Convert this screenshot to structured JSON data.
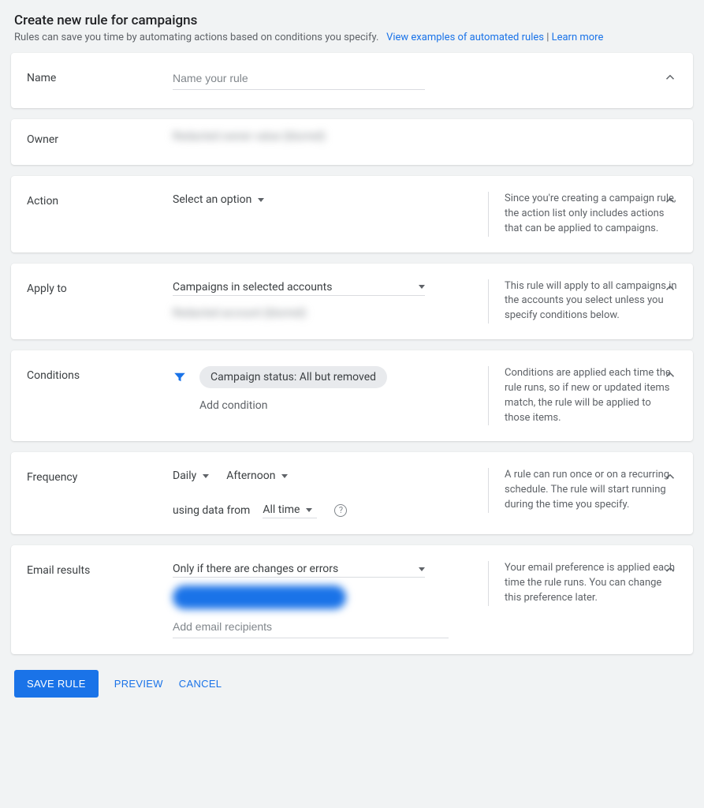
{
  "header": {
    "title": "Create new rule for campaigns",
    "subtitle": "Rules can save you time by automating actions based on conditions you specify.",
    "link_examples": "View examples of automated rules",
    "link_learn": "Learn more",
    "divider": " | "
  },
  "name": {
    "label": "Name",
    "placeholder": "Name your rule"
  },
  "owner": {
    "label": "Owner",
    "value_blurred": "Redacted owner value (blurred)"
  },
  "action": {
    "label": "Action",
    "select_label": "Select an option",
    "help": "Since you're creating a campaign rule, the action list only includes actions that can be applied to campaigns."
  },
  "apply_to": {
    "label": "Apply to",
    "select_label": "Campaigns in selected accounts",
    "selected_blurred": "Redacted account (blurred)",
    "help": "This rule will apply to all campaigns in the accounts you select unless you specify conditions below."
  },
  "conditions": {
    "label": "Conditions",
    "chip": "Campaign status: All but removed",
    "add": "Add condition",
    "help": "Conditions are applied each time the rule runs, so if new or updated items match, the rule will be applied to those items."
  },
  "frequency": {
    "label": "Frequency",
    "period": "Daily",
    "time": "Afternoon",
    "using_label": "using data from",
    "range": "All time",
    "help": "A rule can run once or on a recurring schedule. The rule will start running during the time you specify."
  },
  "email": {
    "label": "Email results",
    "select_label": "Only if there are changes or errors",
    "recipients_placeholder": "Add email recipients",
    "help": "Your email preference is applied each time the rule runs. You can change this preference later."
  },
  "footer": {
    "save": "SAVE RULE",
    "preview": "PREVIEW",
    "cancel": "CANCEL"
  }
}
